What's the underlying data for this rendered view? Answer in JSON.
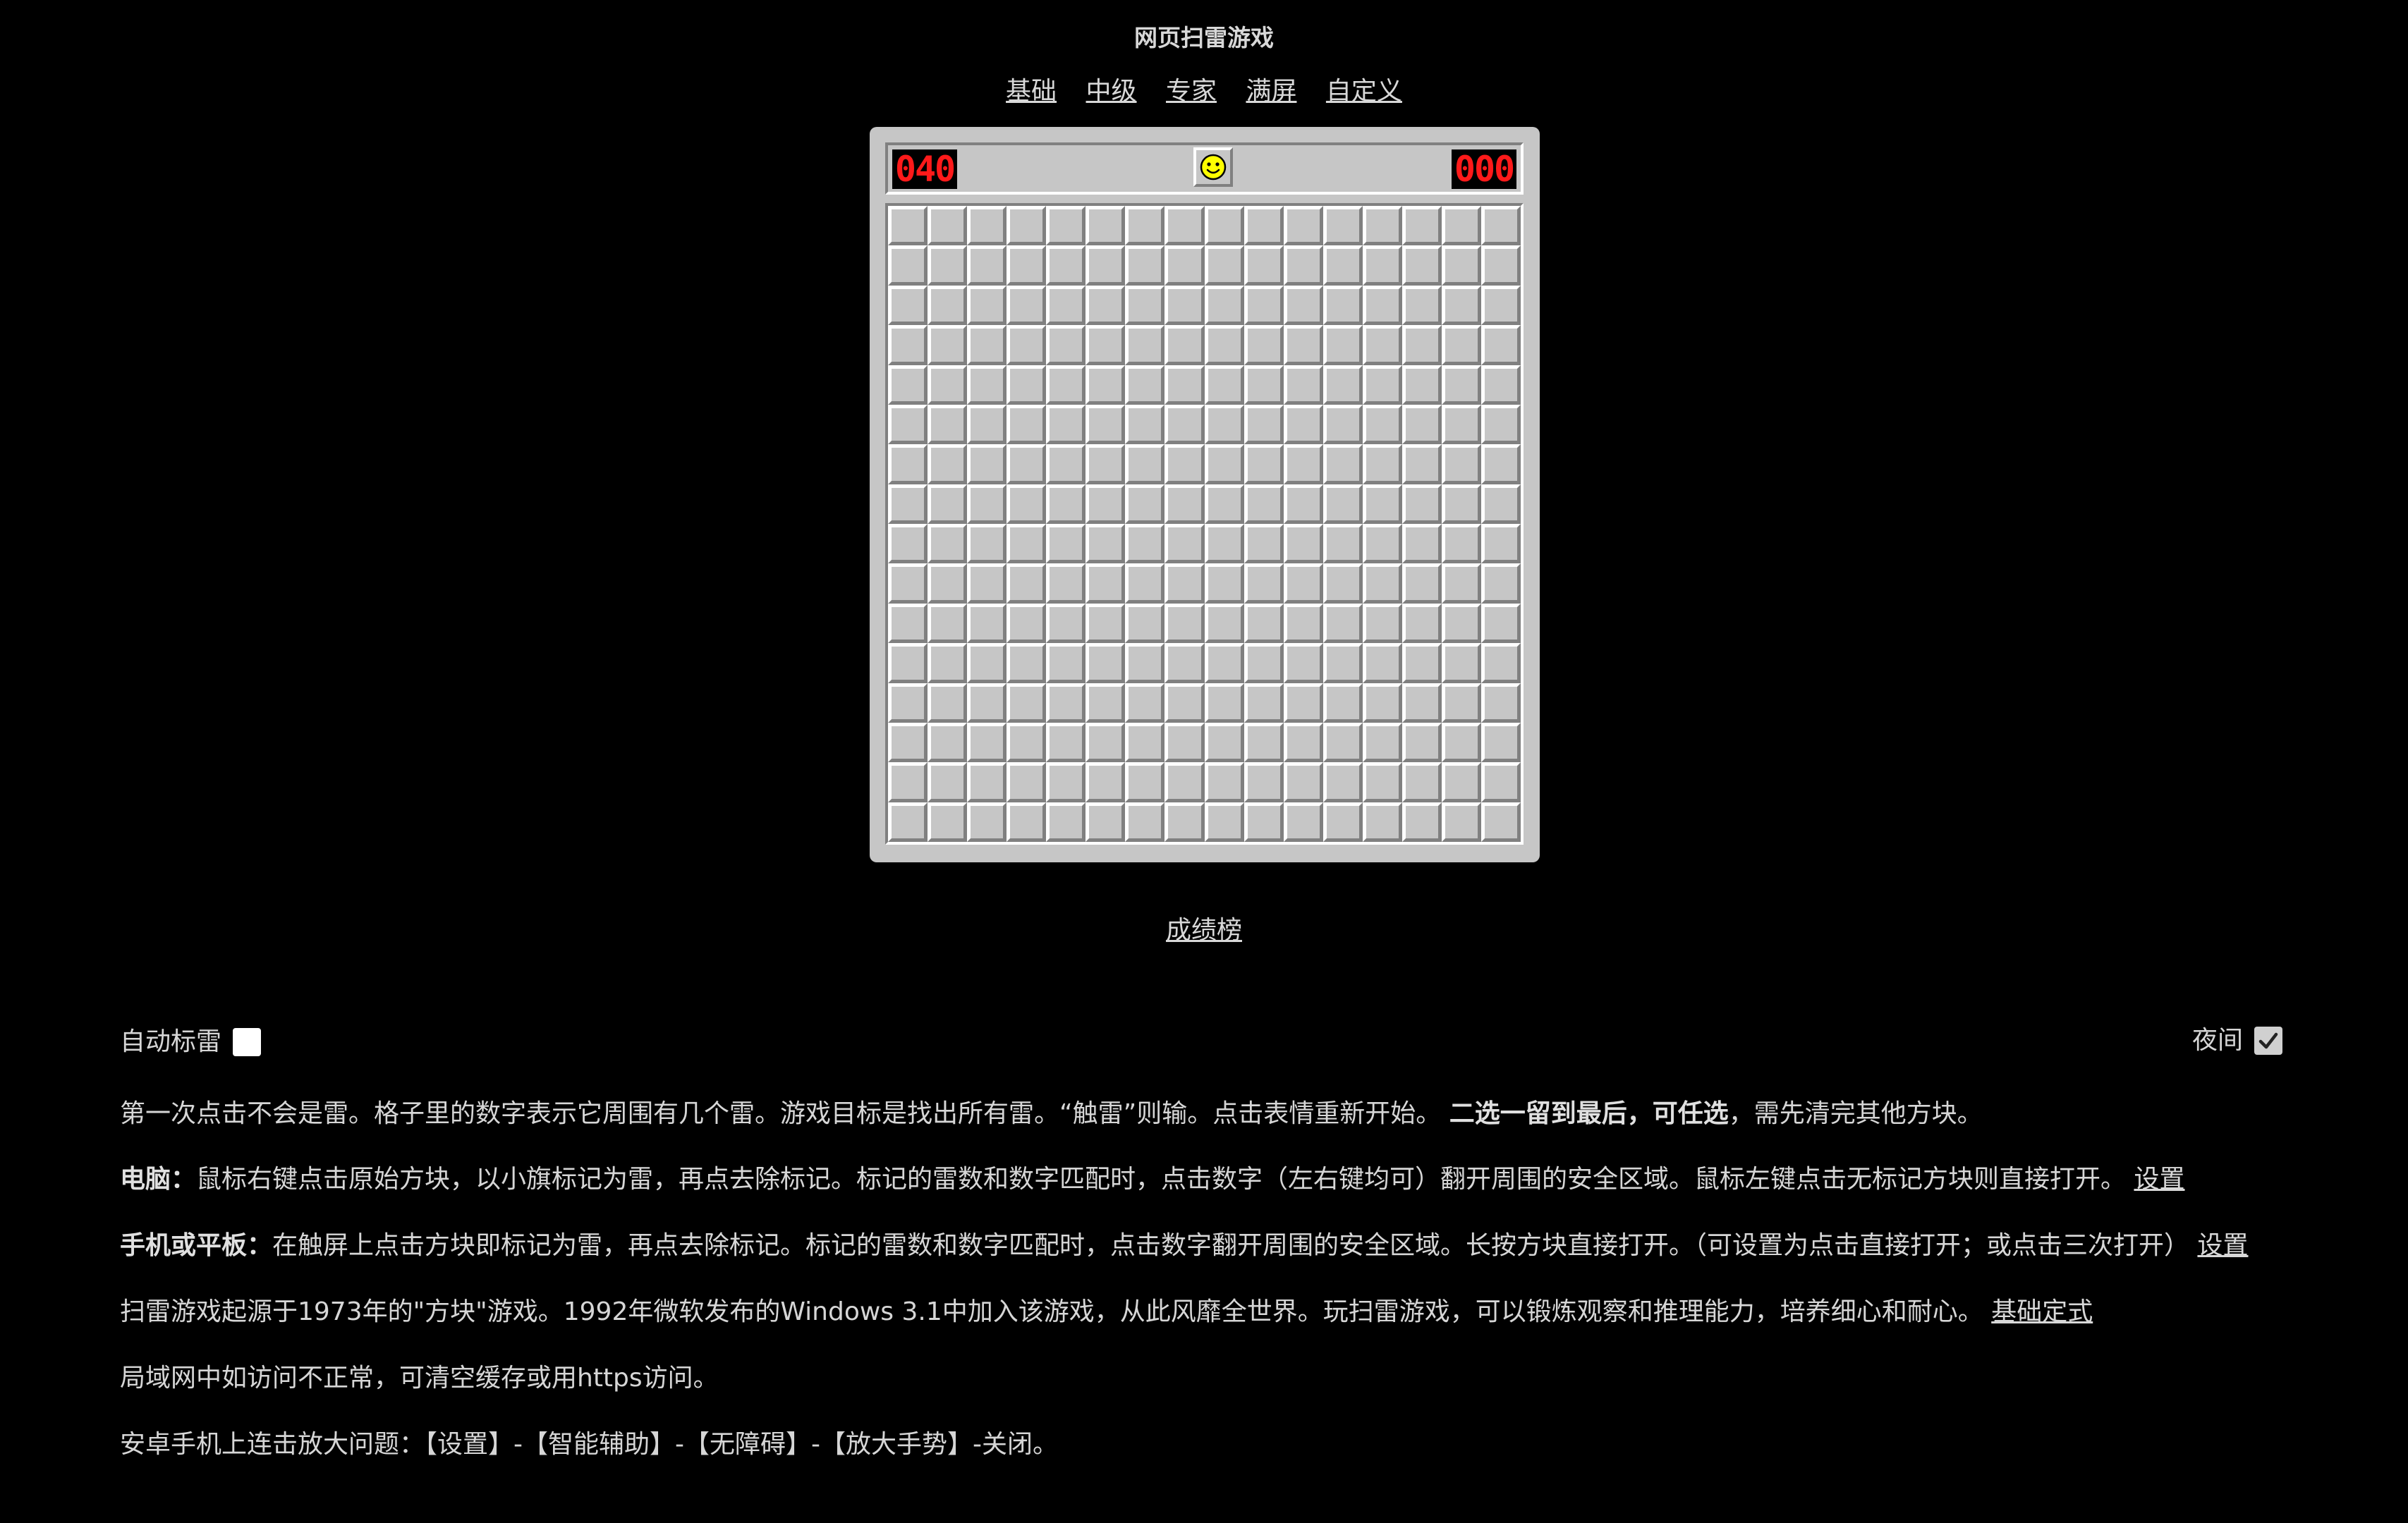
{
  "title": "网页扫雷游戏",
  "levels": [
    "基础",
    "中级",
    "专家",
    "满屏",
    "自定义"
  ],
  "game": {
    "mine_counter": "040",
    "timer": "000",
    "face": "smiley-face-icon",
    "rows": 16,
    "cols": 16
  },
  "leaderboard_label": "成绩榜",
  "options": {
    "auto_flag_label": "自动标雷",
    "auto_flag_checked": false,
    "night_label": "夜间",
    "night_checked": true
  },
  "info": {
    "p1_text_a": "第一次点击不会是雷。格子里的数字表示它周围有几个雷。游戏目标是找出所有雷。“触雷”则输。点击表情重新开始。",
    "p1_bold": "二选一留到最后，可任选",
    "p1_text_b": "，需先清完其他方块。",
    "p2_label": "电脑：",
    "p2_text": "鼠标右键点击原始方块，以小旗标记为雷，再点去除标记。标记的雷数和数字匹配时，点击数字（左右键均可）翻开周围的安全区域。鼠标左键点击无标记方块则直接打开。",
    "p2_link": "设置",
    "p3_label": "手机或平板：",
    "p3_text": "在触屏上点击方块即标记为雷，再点去除标记。标记的雷数和数字匹配时，点击数字翻开周围的安全区域。长按方块直接打开。（可设置为点击直接打开；或点击三次打开）",
    "p3_link": "设置",
    "p4_text": "扫雷游戏起源于1973年的\"方块\"游戏。1992年微软发布的Windows 3.1中加入该游戏，从此风靡全世界。玩扫雷游戏，可以锻炼观察和推理能力，培养细心和耐心。",
    "p4_link": "基础定式",
    "p5_text": "局域网中如访问不正常，可清空缓存或用https访问。",
    "p6_text": "安卓手机上连击放大问题：【设置】-【智能辅助】-【无障碍】-【放大手势】-关闭。"
  },
  "colors": {
    "background": "#000000",
    "board": "#c6c6c6",
    "counter_digits": "#ff1a1a",
    "face": "#ffff00"
  }
}
